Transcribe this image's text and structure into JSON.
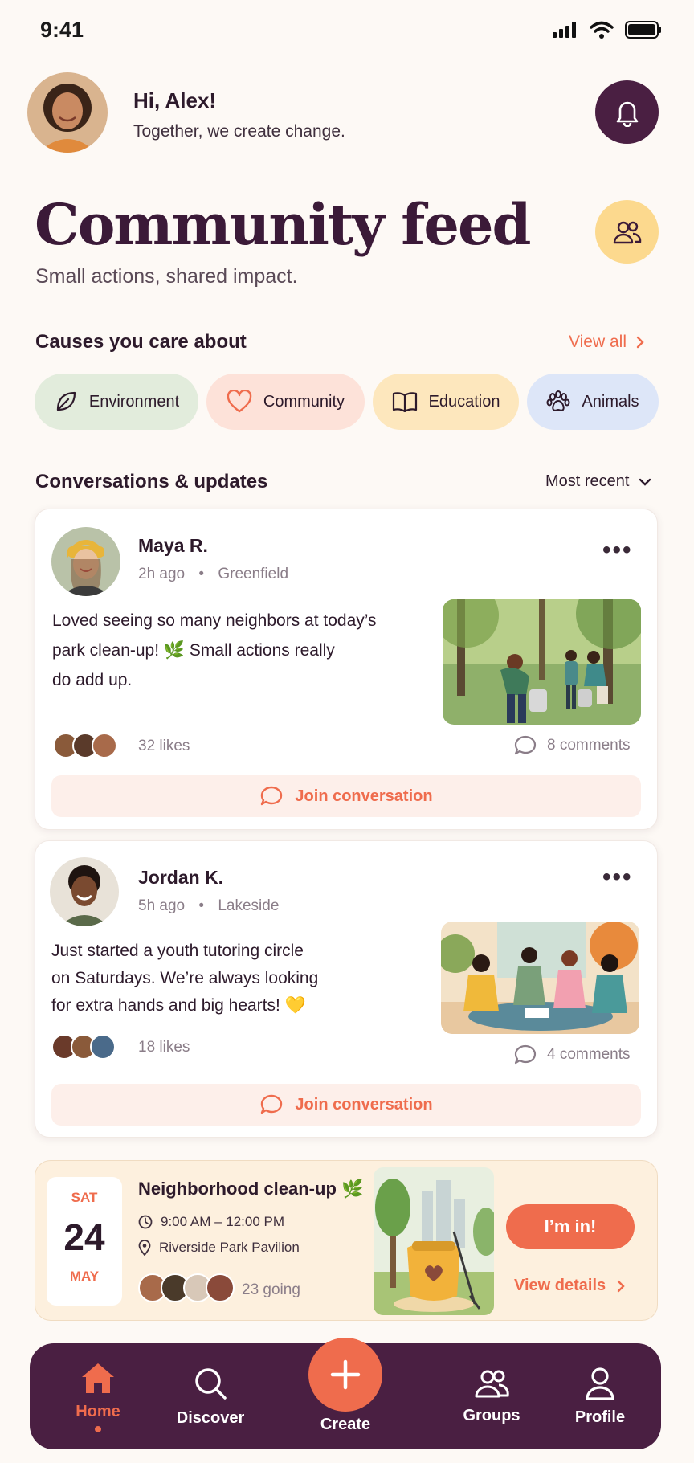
{
  "status": {
    "time": "9:41"
  },
  "header": {
    "greeting": "Hi, Alex!",
    "subtitle": "Together, we create change."
  },
  "page": {
    "title": "Community feed",
    "subtitle": "Small actions, shared impact."
  },
  "causes": {
    "title": "Causes you care about",
    "view_all": "View all",
    "items": [
      {
        "label": "Environment",
        "icon": "leaf-icon"
      },
      {
        "label": "Community",
        "icon": "heart-icon"
      },
      {
        "label": "Education",
        "icon": "book-icon"
      },
      {
        "label": "Animals",
        "icon": "paw-icon"
      }
    ]
  },
  "feed": {
    "title": "Conversations & updates",
    "sort": "Most recent",
    "posts": [
      {
        "name": "Maya R.",
        "time": "2h ago",
        "location": "Greenfield",
        "text_lines": [
          "Loved seeing so many neighbors at today’s",
          "park clean-up! 🌿 Small actions really",
          "do add up."
        ],
        "likes": "32 likes",
        "comments": "8 comments",
        "join": "Join conversation"
      },
      {
        "name": "Jordan K.",
        "time": "5h ago",
        "location": "Lakeside",
        "text_lines": [
          "Just started a youth tutoring circle",
          "on Saturdays. We’re always looking",
          "for extra hands and big hearts! 💛"
        ],
        "likes": "18 likes",
        "comments": "4 comments",
        "join": "Join conversation"
      }
    ]
  },
  "event": {
    "dow": "SAT",
    "day": "24",
    "month": "MAY",
    "title": "Neighborhood clean-up 🌿",
    "time": "9:00 AM – 12:00 PM",
    "place": "Riverside Park Pavilion",
    "going": "23 going",
    "cta": "I’m in!",
    "details": "View details"
  },
  "tabbar": {
    "home": "Home",
    "discover": "Discover",
    "create": "Create",
    "groups": "Groups",
    "profile": "Profile"
  },
  "colors": {
    "accent": "#ef6c4d",
    "brand_dark": "#4a1f42",
    "background": "#fdf9f5"
  }
}
